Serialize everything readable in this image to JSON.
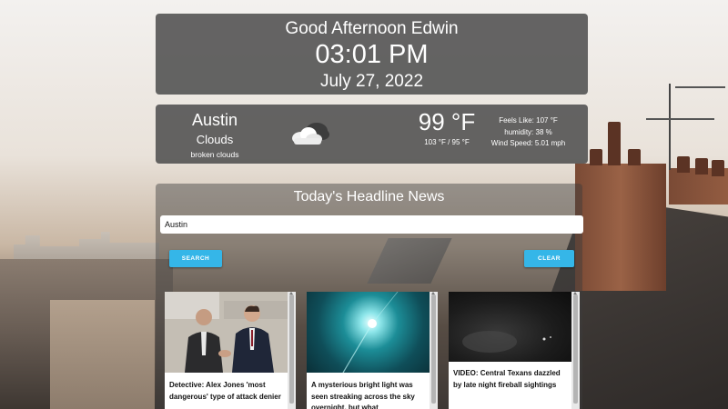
{
  "greeting": {
    "text": "Good Afternoon Edwin",
    "time": "03:01 PM",
    "date": "July 27, 2022"
  },
  "weather": {
    "city": "Austin",
    "condition": "Clouds",
    "description": "broken clouds",
    "icon": "broken-clouds-icon",
    "temperature": "99 °F",
    "range": "103 °F / 95 °F",
    "feels_like": "Feels Like: 107 °F",
    "humidity": "humidity: 38 %",
    "wind": "Wind Speed: 5.01 mph"
  },
  "news": {
    "title": "Today's Headline News",
    "search_value": "Austin",
    "search_button": "SEARCH",
    "clear_button": "CLEAR",
    "articles": [
      {
        "headline": "Detective: Alex Jones 'most dangerous' type of attack denier",
        "image": "two-men-shaking-hands"
      },
      {
        "headline": "A mysterious bright light was seen streaking across the sky overnight, but what",
        "image": "bright-light-in-sky"
      },
      {
        "headline": "VIDEO: Central Texans dazzled by late night fireball sightings",
        "image": "night-security-camera"
      }
    ]
  },
  "colors": {
    "panel": "#505050",
    "button": "#35b6e8"
  }
}
